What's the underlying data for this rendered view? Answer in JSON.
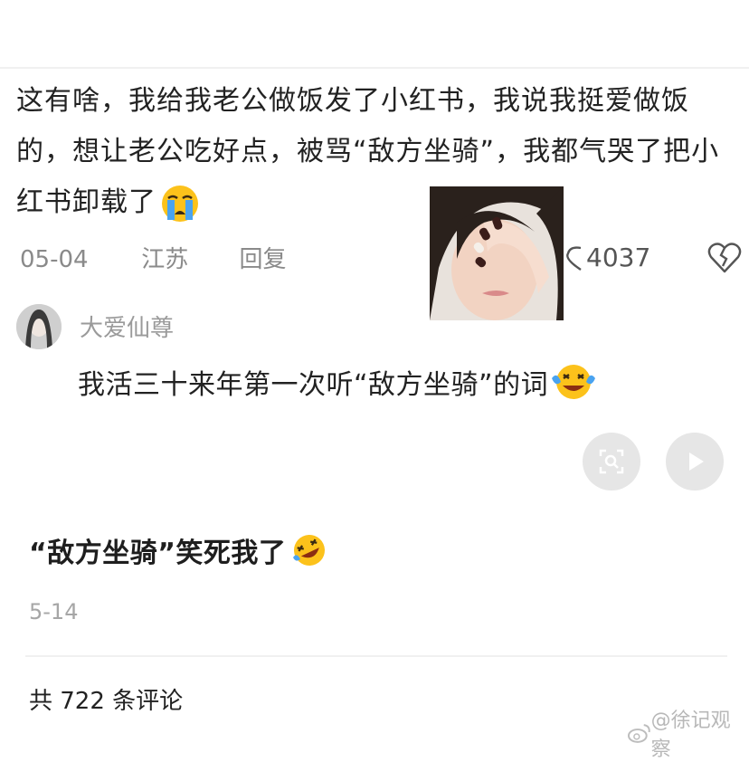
{
  "comment": {
    "text": "这有啥，我给我老公做饭发了小红书，我说我挺爱做饭的，想让老公吃好点，被骂“敌方坐骑”，我都气哭了把小红书卸载了",
    "date": "05-04",
    "location": "江苏",
    "reply_label": "回复",
    "like_count": "4037",
    "emoji": "loudly-crying-emoji"
  },
  "reply": {
    "username": "大爱仙尊",
    "text": "我活三十来年第一次听“敌方坐骑”的词",
    "emoji": "crying-laughing-emoji"
  },
  "post": {
    "caption": "“敌方坐骑”笑死我了",
    "emoji": "rofl-emoji",
    "date": "5-14",
    "comment_count": "共 722 条评论"
  },
  "watermark": {
    "text": "@徐记观察"
  },
  "colors": {
    "text_primary": "#222222",
    "text_meta": "#8a8a8a",
    "button_bg": "#e6e6e6"
  }
}
